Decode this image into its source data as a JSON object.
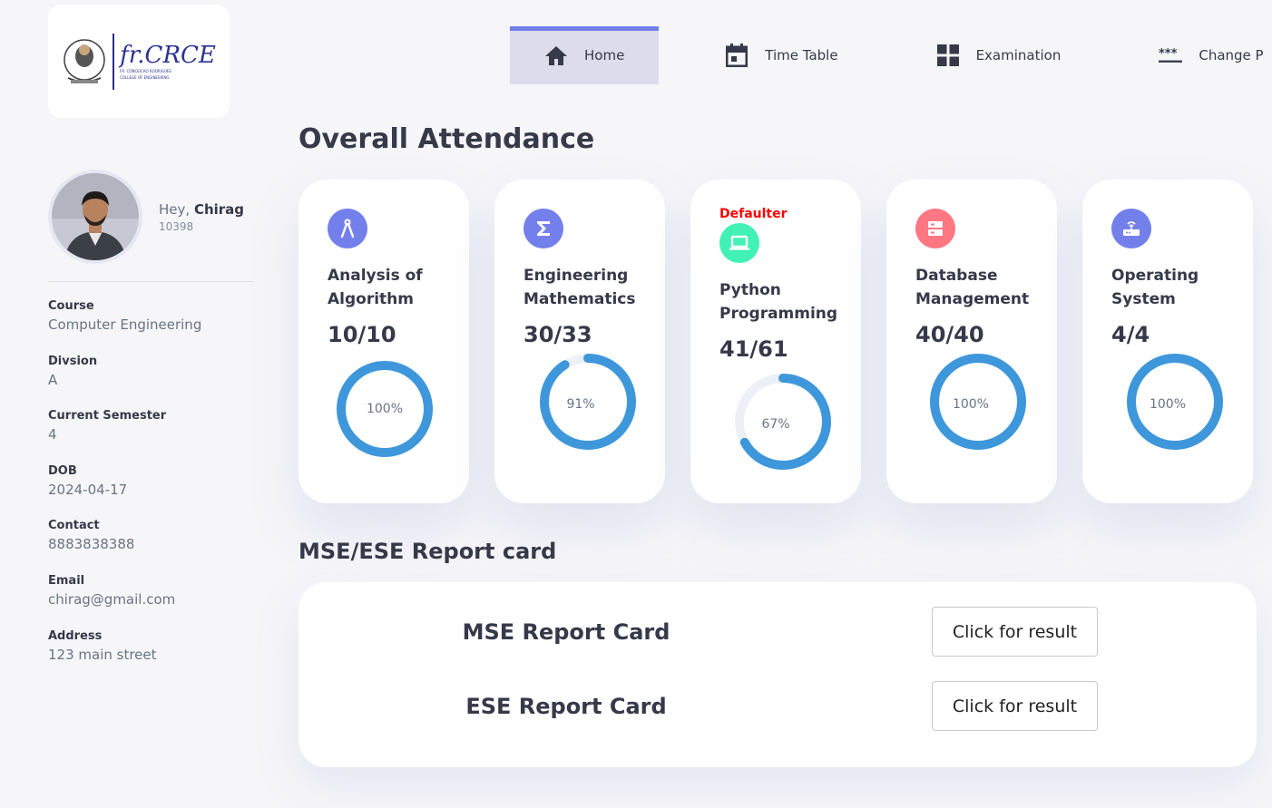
{
  "logo": {
    "brand": "fr.CRCE",
    "fineprint": [
      "FR. CONCEICAO RODRIGUES",
      "COLLEGE OF ENGINEERING"
    ]
  },
  "nav": {
    "items": [
      {
        "label": "Home",
        "icon": "home-icon"
      },
      {
        "label": "Time Table",
        "icon": "calendar-icon"
      },
      {
        "label": "Examination",
        "icon": "grid-icon"
      },
      {
        "label": "Change P",
        "icon": "password-icon"
      }
    ]
  },
  "profile": {
    "greeting": "Hey,",
    "name": "Chirag",
    "id": "10398"
  },
  "info": [
    {
      "label": "Course",
      "value": "Computer Engineering"
    },
    {
      "label": "Divsion",
      "value": "A"
    },
    {
      "label": "Current Semester",
      "value": "4"
    },
    {
      "label": "DOB",
      "value": "2024-04-17"
    },
    {
      "label": "Contact",
      "value": "8883838388"
    },
    {
      "label": "Email",
      "value": "chirag@gmail.com"
    },
    {
      "label": "Address",
      "value": "123 main street"
    }
  ],
  "attendance": {
    "title": "Overall Attendance",
    "subjects": [
      {
        "name": "Analysis of Algorithm",
        "count": "10/10",
        "percent_label": "100%",
        "percent": 100,
        "defaulter": "",
        "icon": "compass-icon",
        "color": "#7380ec"
      },
      {
        "name": "Engineering Mathematics",
        "count": "30/33",
        "percent_label": "91%",
        "percent": 91,
        "defaulter": "",
        "icon": "sigma-icon",
        "color": "#7380ec"
      },
      {
        "name": "Python Programming",
        "count": "41/61",
        "percent_label": "67%",
        "percent": 67,
        "defaulter": "Defaulter",
        "icon": "laptop-icon",
        "color": "#41f1b6"
      },
      {
        "name": "Database Management",
        "count": "40/40",
        "percent_label": "100%",
        "percent": 100,
        "defaulter": "",
        "icon": "database-icon",
        "color": "#ff7782"
      },
      {
        "name": "Operating System",
        "count": "4/4",
        "percent_label": "100%",
        "percent": 100,
        "defaulter": "",
        "icon": "router-icon",
        "color": "#7380ec"
      }
    ],
    "ring_color": "#3e97da"
  },
  "report": {
    "title": "MSE/ESE Report card",
    "rows": [
      {
        "title": "MSE Report Card",
        "button": "Click for result"
      },
      {
        "title": "ESE Report Card",
        "button": "Click for result"
      }
    ]
  }
}
